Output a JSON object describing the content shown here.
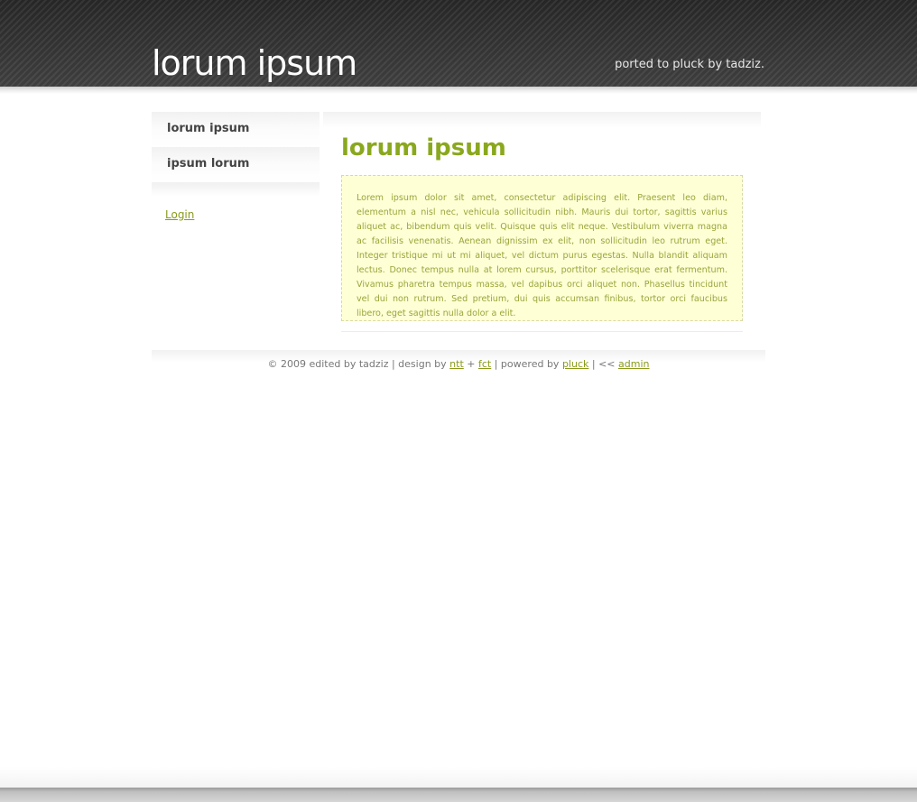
{
  "header": {
    "site_title": "lorum ipsum",
    "tagline": "ported to pluck by tadziz."
  },
  "sidebar": {
    "items": [
      {
        "label": "lorum ipsum"
      },
      {
        "label": "ipsum lorum"
      }
    ],
    "login_label": "Login"
  },
  "main": {
    "title": "lorum ipsum",
    "body": "Lorem ipsum dolor sit amet, consectetur adipiscing elit. Praesent leo diam, elementum a nisl nec, vehicula sollicitudin nibh. Mauris dui tortor, sagittis varius aliquet ac, bibendum quis velit. Quisque quis elit neque. Vestibulum viverra magna ac facilisis venenatis. Aenean dignissim ex elit, non sollicitudin leo rutrum eget. Integer tristique mi ut mi aliquet, vel dictum purus egestas. Nulla blandit aliquam lectus. Donec tempus nulla at lorem cursus, porttitor scelerisque erat fermentum. Vivamus pharetra tempus massa, vel dapibus orci aliquet non. Phasellus tincidunt vel dui non rutrum. Sed pretium, dui quis accumsan finibus, tortor orci faucibus libero, eget sagittis nulla dolor a elit."
  },
  "footer": {
    "prefix": "© 2009 edited by tadziz | design by ",
    "ntt_link": "ntt",
    "plus": " + ",
    "fct_link": "fct",
    "powered_by": " | powered by ",
    "pluck_link": "pluck",
    "separator": " | << ",
    "admin_link": "admin"
  },
  "colors": {
    "accent": "#8aa81e",
    "link": "#8a9a1b",
    "note_background": "#ffffd6",
    "header_background": "#3a3a3a"
  }
}
